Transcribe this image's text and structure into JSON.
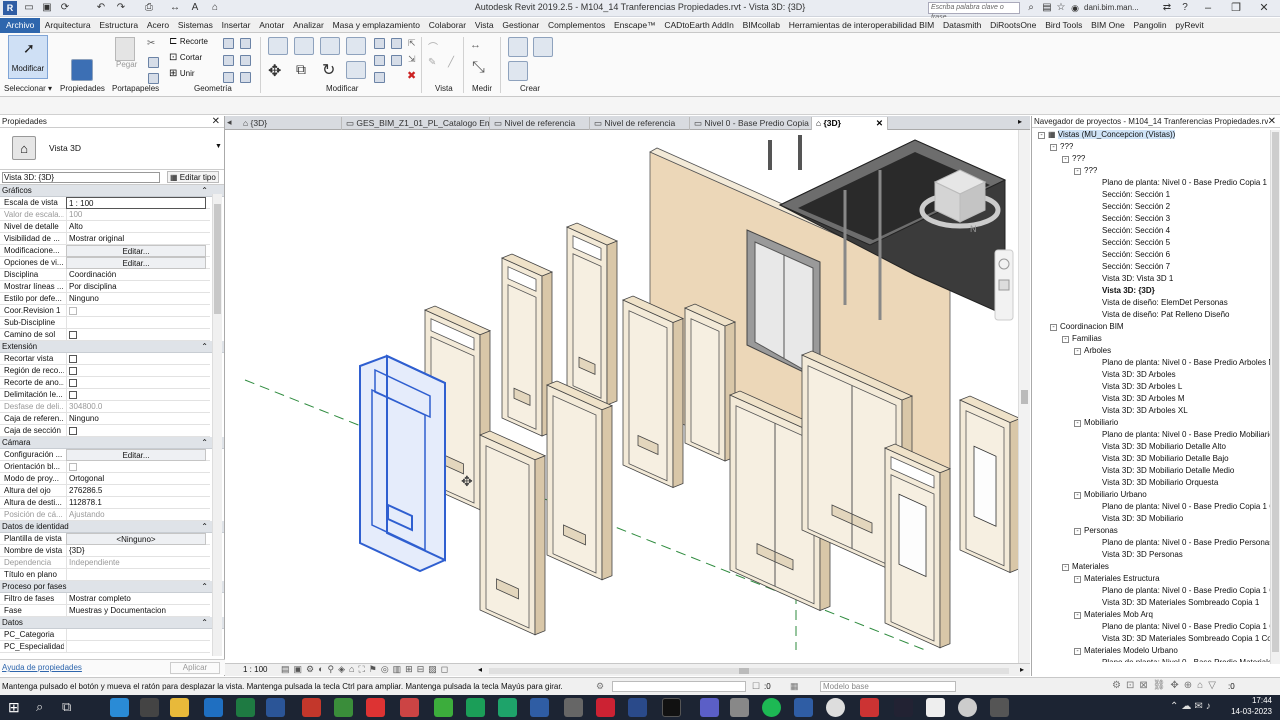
{
  "title_bar": {
    "title": "Autodesk Revit 2019.2.5 - M104_14 Tranferencias Propiedades.rvt - Vista 3D: {3D}",
    "search_placeholder": "Escriba palabra clave o frase",
    "user": "dani.bim.man...",
    "help": "?"
  },
  "menu": [
    "Archivo",
    "Arquitectura",
    "Estructura",
    "Acero",
    "Sistemas",
    "Insertar",
    "Anotar",
    "Analizar",
    "Masa y emplazamiento",
    "Colaborar",
    "Vista",
    "Gestionar",
    "Complementos",
    "Enscape™",
    "CADtoEarth AddIn",
    "BIMcollab",
    "Herramientas de interoperabilidad BIM",
    "Datasmith",
    "DiRootsOne",
    "Bird Tools",
    "BIM One",
    "Pangolin",
    "pyRevit"
  ],
  "ribbon": {
    "modify_label": "Modificar",
    "recorte": "Recorte",
    "cortar": "Cortar",
    "unir": "Unir",
    "pegar": "Pegar",
    "panels": [
      "Seleccionar ▾",
      "Propiedades",
      "Portapapeles",
      "Geometría",
      "Modificar",
      "Vista",
      "Medir",
      "Crear"
    ]
  },
  "properties": {
    "title": "Propiedades",
    "type_name": "Vista 3D",
    "selector": "Vista 3D: {3D}",
    "edit_type": "Editar tipo",
    "sections": [
      {
        "name": "Gráficos",
        "rows": [
          {
            "k": "Escala de vista",
            "v": "1 : 100",
            "kind": "inp"
          },
          {
            "k": "Valor de escala...",
            "v": "100",
            "kind": "dis"
          },
          {
            "k": "Nivel de detalle",
            "v": "Alto"
          },
          {
            "k": "Visibilidad de ...",
            "v": "Mostrar original"
          },
          {
            "k": "Modificacione...",
            "v": "Editar...",
            "kind": "btn"
          },
          {
            "k": "Opciones de vi...",
            "v": "Editar...",
            "kind": "btn"
          },
          {
            "k": "Disciplina",
            "v": "Coordinación"
          },
          {
            "k": "Mostrar líneas ...",
            "v": "Por disciplina"
          },
          {
            "k": "Estilo por defe...",
            "v": "Ninguno"
          },
          {
            "k": "Coor.Revision 1",
            "v": "☐",
            "kind": "cbdis"
          },
          {
            "k": "Sub-Discipline",
            "v": ""
          },
          {
            "k": "Camino de sol",
            "v": "☐",
            "kind": "cb"
          }
        ]
      },
      {
        "name": "Extensión",
        "rows": [
          {
            "k": "Recortar vista",
            "v": "☐",
            "kind": "cb"
          },
          {
            "k": "Región de reco...",
            "v": "☐",
            "kind": "cb"
          },
          {
            "k": "Recorte de ano...",
            "v": "☐",
            "kind": "cb"
          },
          {
            "k": "Delimitación le...",
            "v": "☐",
            "kind": "cb"
          },
          {
            "k": "Desfase de deli...",
            "v": "304800.0",
            "kind": "dis"
          },
          {
            "k": "Caja de referen...",
            "v": "Ninguno"
          },
          {
            "k": "Caja de sección",
            "v": "☐",
            "kind": "cb"
          }
        ]
      },
      {
        "name": "Cámara",
        "rows": [
          {
            "k": "Configuración ...",
            "v": "Editar...",
            "kind": "btn"
          },
          {
            "k": "Orientación bl...",
            "v": "☐",
            "kind": "cbdis"
          },
          {
            "k": "Modo de proy...",
            "v": "Ortogonal"
          },
          {
            "k": "Altura del ojo",
            "v": "276286.5"
          },
          {
            "k": "Altura de desti...",
            "v": "112878.1"
          },
          {
            "k": "Posición de cá...",
            "v": "Ajustando",
            "kind": "dis"
          }
        ]
      },
      {
        "name": "Datos de identidad",
        "rows": [
          {
            "k": "Plantilla de vista",
            "v": "<Ninguno>",
            "kind": "btn"
          },
          {
            "k": "Nombre de vista",
            "v": "{3D}"
          },
          {
            "k": "Dependencia",
            "v": "Independiente",
            "kind": "dis"
          },
          {
            "k": "Título en plano",
            "v": ""
          }
        ]
      },
      {
        "name": "Proceso por fases",
        "rows": [
          {
            "k": "Filtro de fases",
            "v": "Mostrar completo"
          },
          {
            "k": "Fase",
            "v": "Muestras y Documentacion"
          }
        ]
      },
      {
        "name": "Datos",
        "rows": [
          {
            "k": "PC_Categoria",
            "v": ""
          },
          {
            "k": "PC_Especialidad",
            "v": ""
          }
        ]
      }
    ],
    "help_link": "Ayuda de propiedades",
    "apply": "Aplicar"
  },
  "tabs": [
    {
      "label": "{3D}",
      "active": false
    },
    {
      "label": "GES_BIM_Z1_01_PL_Catalogo Entid...",
      "active": false
    },
    {
      "label": "Nivel de referencia",
      "active": false
    },
    {
      "label": "Nivel de referencia",
      "active": false
    },
    {
      "label": "Nivel 0 - Base Predio Copia 1",
      "active": false
    },
    {
      "label": "{3D}",
      "active": true
    }
  ],
  "view_bar": {
    "scale": "1 : 100"
  },
  "browser": {
    "title": "Navegador de proyectos - M104_14 Tranferencias Propiedades.rvt",
    "nodes": [
      {
        "t": "Vistas (MU_Concepcion (Vistas))",
        "lvl": 0,
        "tog": "-",
        "sel": true
      },
      {
        "t": "???",
        "lvl": 1,
        "tog": "-"
      },
      {
        "t": "???",
        "lvl": 2,
        "tog": "-"
      },
      {
        "t": "???",
        "lvl": 3,
        "tog": "-"
      },
      {
        "t": "Plano de planta: Nivel 0 - Base Predio Copia 1",
        "lvl": 4
      },
      {
        "t": "Sección: Sección 1",
        "lvl": 4
      },
      {
        "t": "Sección: Sección 2",
        "lvl": 4
      },
      {
        "t": "Sección: Sección 3",
        "lvl": 4
      },
      {
        "t": "Sección: Sección 4",
        "lvl": 4
      },
      {
        "t": "Sección: Sección 5",
        "lvl": 4
      },
      {
        "t": "Sección: Sección 6",
        "lvl": 4
      },
      {
        "t": "Sección: Sección 7",
        "lvl": 4
      },
      {
        "t": "Vista 3D: Vista 3D 1",
        "lvl": 4
      },
      {
        "t": "Vista 3D: {3D}",
        "lvl": 4,
        "bold": true
      },
      {
        "t": "Vista de diseño: ElemDet Personas",
        "lvl": 4
      },
      {
        "t": "Vista de diseño: Pat Relleno Diseño",
        "lvl": 4
      },
      {
        "t": "Coordinacion BIM",
        "lvl": 1,
        "tog": "-"
      },
      {
        "t": "Familias",
        "lvl": 2,
        "tog": "-"
      },
      {
        "t": "Arboles",
        "lvl": 3,
        "tog": "-"
      },
      {
        "t": "Plano de planta: Nivel 0 - Base Predio Arboles M",
        "lvl": 4
      },
      {
        "t": "Vista 3D: 3D Arboles",
        "lvl": 4
      },
      {
        "t": "Vista 3D: 3D Arboles L",
        "lvl": 4
      },
      {
        "t": "Vista 3D: 3D Arboles M",
        "lvl": 4
      },
      {
        "t": "Vista 3D: 3D Arboles XL",
        "lvl": 4
      },
      {
        "t": "Mobiliario",
        "lvl": 3,
        "tog": "-"
      },
      {
        "t": "Plano de planta: Nivel 0 - Base Predio Mobiliario",
        "lvl": 4
      },
      {
        "t": "Vista 3D: 3D Mobiliario Detalle Alto",
        "lvl": 4
      },
      {
        "t": "Vista 3D: 3D Mobiliario Detalle Bajo",
        "lvl": 4
      },
      {
        "t": "Vista 3D: 3D Mobiliario Detalle Medio",
        "lvl": 4
      },
      {
        "t": "Vista 3D: 3D Mobiliario Orquesta",
        "lvl": 4
      },
      {
        "t": "Mobiliario Urbano",
        "lvl": 3,
        "tog": "-"
      },
      {
        "t": "Plano de planta: Nivel 0 - Base Predio Copia 1 C",
        "lvl": 4
      },
      {
        "t": "Vista 3D: 3D Mobiliario",
        "lvl": 4
      },
      {
        "t": "Personas",
        "lvl": 3,
        "tog": "-"
      },
      {
        "t": "Plano de planta: Nivel 0 - Base Predio Personas",
        "lvl": 4
      },
      {
        "t": "Vista 3D: 3D Personas",
        "lvl": 4
      },
      {
        "t": "Materiales",
        "lvl": 2,
        "tog": "-"
      },
      {
        "t": "Materiales Estructura",
        "lvl": 3,
        "tog": "-"
      },
      {
        "t": "Plano de planta: Nivel 0 - Base Predio Copia 1 C",
        "lvl": 4
      },
      {
        "t": "Vista 3D: 3D Materiales Sombreado Copia 1",
        "lvl": 4
      },
      {
        "t": "Materiales Mob Arq",
        "lvl": 3,
        "tog": "-"
      },
      {
        "t": "Plano de planta: Nivel 0 - Base Predio Copia 1 C",
        "lvl": 4
      },
      {
        "t": "Vista 3D: 3D Materiales Sombreado Copia 1 Cop",
        "lvl": 4
      },
      {
        "t": "Materiales Modelo Urbano",
        "lvl": 3,
        "tog": "-"
      },
      {
        "t": "Plano de planta: Nivel 0 - Base Predio  Materiale",
        "lvl": 4
      }
    ]
  },
  "status": {
    "message": "Mantenga pulsado el botón y mueva el ratón para desplazar la vista. Mantenga pulsada la tecla Ctrl para ampliar. Mantenga pulsada la tecla Mayús para girar.",
    "sel_count": ":0",
    "model": "Modelo base",
    "filter_count": ":0"
  },
  "taskbar": {
    "time": "17:44",
    "date": "14-03-2023"
  },
  "colors": {
    "accent": "#2e66ad",
    "selected_door": "#2f5fd0",
    "door_fill": "#f3ead8",
    "wall_fill": "#ecd7b8"
  }
}
